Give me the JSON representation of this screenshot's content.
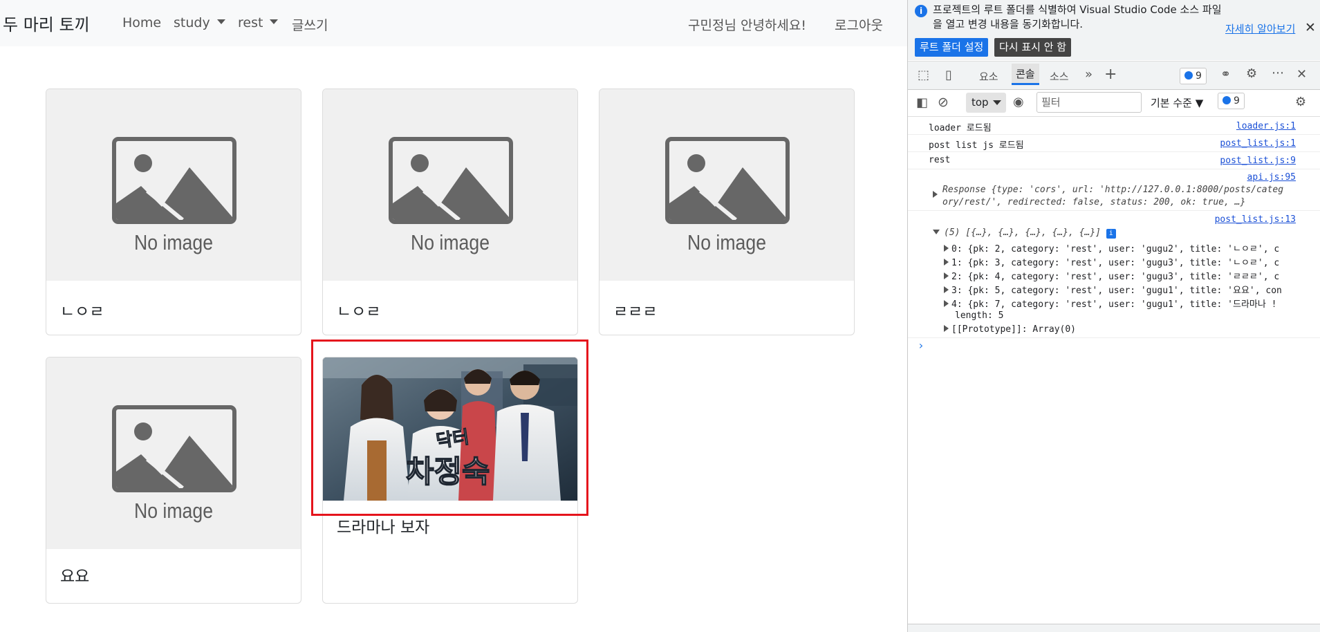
{
  "navbar": {
    "brand": "두 마리 토끼",
    "items": [
      "Home",
      "study",
      "rest",
      "글쓰기"
    ],
    "greeting": "구민정님 안녕하세요!",
    "logout": "로그아웃"
  },
  "cards": [
    {
      "title": "ㄴㅇㄹ",
      "image": "No image"
    },
    {
      "title": "ㄴㅇㄹ",
      "image": "No image"
    },
    {
      "title": "ㄹㄹㄹ",
      "image": "No image"
    },
    {
      "title": "요요",
      "image": "No image"
    },
    {
      "title": "드라마나 보자"
    }
  ],
  "photo": {
    "poster_small": "닥터",
    "poster_big": "차정숙"
  },
  "devtools": {
    "info_text": "프로젝트의 루트 폴더를 식별하여 Visual Studio Code 소스 파일을 열고 변경 내용을 동기화합니다.",
    "info_link": "자세히 알아보기",
    "set_root_button": "루트 폴더 설정",
    "dont_show_button": "다시 표시 안 함",
    "tabs": [
      "요소",
      "콘솔",
      "소스"
    ],
    "issues_count": "9",
    "context": "top",
    "filter_placeholder": "필터",
    "level": "기본 수준",
    "level_count": "9",
    "logs": [
      {
        "msg": "loader 로드됨",
        "src": "loader.js:1"
      },
      {
        "msg": "post list js 로드됨",
        "src": "post_list.js:1"
      },
      {
        "msg": "rest",
        "src": "post_list.js:9"
      }
    ],
    "response_src": "api.js:95",
    "response_line1": "Response {type: 'cors', url: 'http://127.0.0.1:8000/posts/categ",
    "response_line2": "ory/rest/', redirected: false, status: 200, ok: true, …}",
    "array_src": "post_list.js:13",
    "array_header": "(5) [{…}, {…}, {…}, {…}, {…}]",
    "array_items": [
      "0: {pk: 2, category: 'rest', user: 'gugu2', title: 'ㄴㅇㄹ', c",
      "1: {pk: 3, category: 'rest', user: 'gugu3', title: 'ㄴㅇㄹ', c",
      "2: {pk: 4, category: 'rest', user: 'gugu3', title: 'ㄹㄹㄹ', c",
      "3: {pk: 5, category: 'rest', user: 'gugu1', title: '요요', con",
      "4: {pk: 7, category: 'rest', user: 'gugu1', title: '드라마나 !"
    ],
    "length_line": "length: 5",
    "prototype_line": "[[Prototype]]: Array(0)",
    "prompt": "›"
  }
}
